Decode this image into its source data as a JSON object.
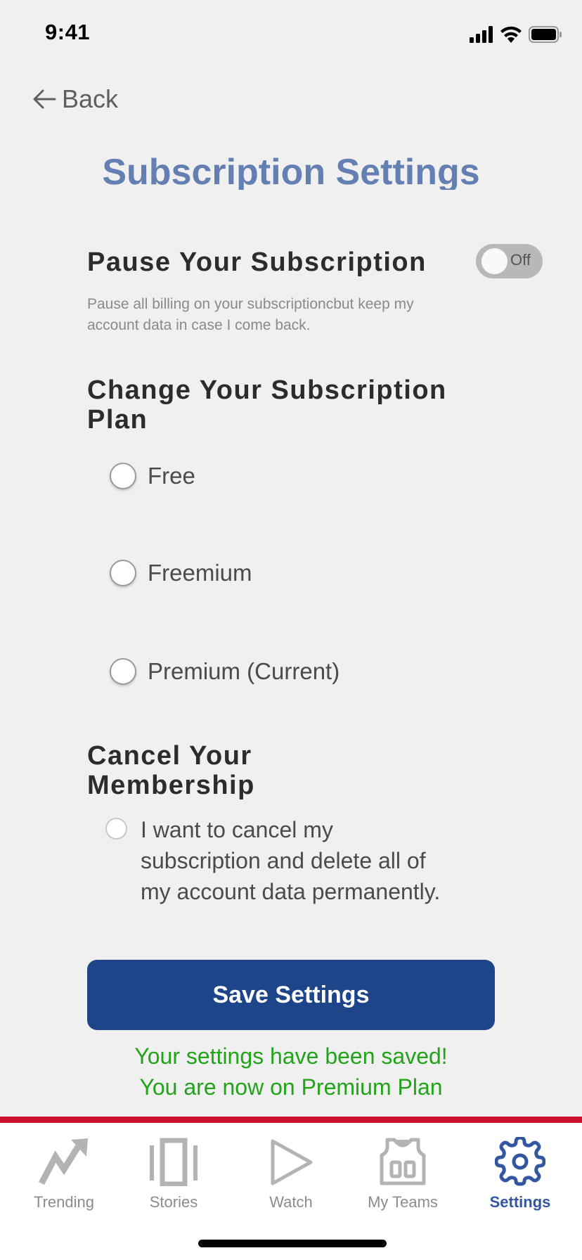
{
  "status_bar": {
    "time": "9:41",
    "icons": [
      "cellular-signal-icon",
      "wifi-icon",
      "battery-icon"
    ]
  },
  "nav": {
    "back_label": "Back",
    "back_icon": "arrow-left-icon"
  },
  "page_title": "Subscription Settings",
  "pause": {
    "title": "Pause Your Subscription",
    "toggle_label": "Off",
    "toggle_on": false,
    "description": "Pause all billing on your subscriptioncbut keep my account data in case I come back."
  },
  "plan": {
    "title": "Change Your Subscription Plan",
    "options": [
      {
        "label": "Free",
        "selected": false
      },
      {
        "label": "Freemium",
        "selected": false
      },
      {
        "label": "Premium (Current)",
        "selected": false
      }
    ]
  },
  "cancel": {
    "title": "Cancel Your Membership",
    "checkbox_label": "I want to cancel my subscription and delete all of my account data permanently.",
    "checked": false
  },
  "save_button": {
    "label": "Save Settings",
    "color": "#1e4489"
  },
  "saved_message": {
    "line1": "Your settings have been saved!",
    "line2": "You are now on Premium Plan",
    "color": "#22a31a"
  },
  "accent_colors": {
    "title": "#6480b3",
    "tab_active": "#3256a0",
    "tab_divider": "#cc0f2d"
  },
  "tabbar": {
    "tabs": [
      {
        "label": "Trending",
        "icon": "trending-icon",
        "active": false
      },
      {
        "label": "Stories",
        "icon": "stories-icon",
        "active": false
      },
      {
        "label": "Watch",
        "icon": "play-icon",
        "active": false
      },
      {
        "label": "My Teams",
        "icon": "jersey-icon",
        "active": false
      },
      {
        "label": "Settings",
        "icon": "gear-icon",
        "active": true
      }
    ]
  }
}
